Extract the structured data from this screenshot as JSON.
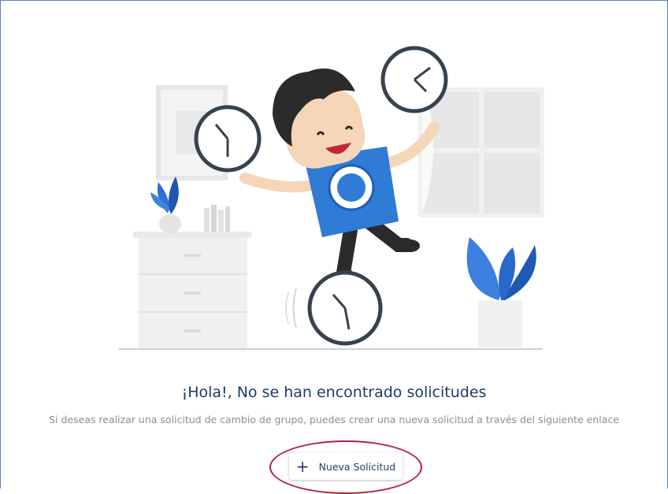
{
  "empty_state": {
    "title": "¡Hola!, No se han encontrado solicitudes",
    "message": "Si deseas realizar una solicitud de cambio de grupo, puedes crear una nueva solicitud a través del siguiente enlace",
    "illustration": "person-juggling-clocks"
  },
  "actions": {
    "new_request_icon": "plus-icon",
    "new_request_label": "Nueva Solicitud"
  },
  "colors": {
    "title": "#1f3a68",
    "highlight_ring": "#b3233f",
    "frame_border": "#5b7fc7"
  }
}
